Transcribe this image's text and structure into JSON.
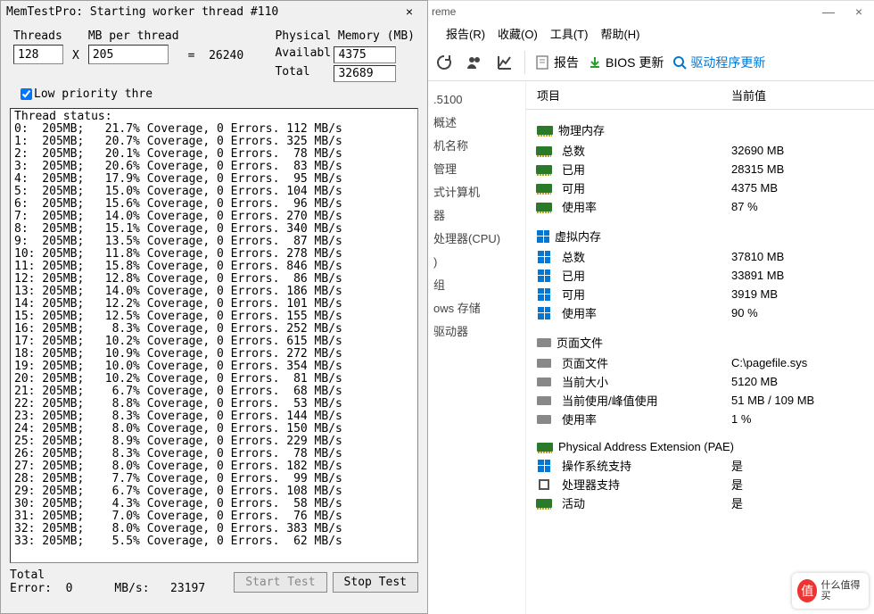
{
  "memtest": {
    "title": "MemTestPro: Starting worker thread #110",
    "close": "×",
    "threads_label": "Threads",
    "threads_value": "128",
    "x": "X",
    "mb_per_thread_label": "MB per thread",
    "mb_per_thread_value": "205",
    "equals": "=",
    "result": "26240",
    "phys_mem_header": "Physical Memory (MB)",
    "available_label": "Availabl",
    "available_value": "4375",
    "total_label": "Total",
    "total_value": "32689",
    "low_priority_label": "Low priority thre",
    "status_header": "Thread status:",
    "threads": [
      {
        "id": "0",
        "mb": "205MB",
        "cov": "21.7%",
        "err": "0",
        "rate": "112"
      },
      {
        "id": "1",
        "mb": "205MB",
        "cov": "20.7%",
        "err": "0",
        "rate": "325"
      },
      {
        "id": "2",
        "mb": "205MB",
        "cov": "20.1%",
        "err": "0",
        "rate": "78"
      },
      {
        "id": "3",
        "mb": "205MB",
        "cov": "20.6%",
        "err": "0",
        "rate": "83"
      },
      {
        "id": "4",
        "mb": "205MB",
        "cov": "17.9%",
        "err": "0",
        "rate": "95"
      },
      {
        "id": "5",
        "mb": "205MB",
        "cov": "15.0%",
        "err": "0",
        "rate": "104"
      },
      {
        "id": "6",
        "mb": "205MB",
        "cov": "15.6%",
        "err": "0",
        "rate": "96"
      },
      {
        "id": "7",
        "mb": "205MB",
        "cov": "14.0%",
        "err": "0",
        "rate": "270"
      },
      {
        "id": "8",
        "mb": "205MB",
        "cov": "15.1%",
        "err": "0",
        "rate": "340"
      },
      {
        "id": "9",
        "mb": "205MB",
        "cov": "13.5%",
        "err": "0",
        "rate": "87"
      },
      {
        "id": "10",
        "mb": "205MB",
        "cov": "11.8%",
        "err": "0",
        "rate": "278"
      },
      {
        "id": "11",
        "mb": "205MB",
        "cov": "15.8%",
        "err": "0",
        "rate": "846"
      },
      {
        "id": "12",
        "mb": "205MB",
        "cov": "12.8%",
        "err": "0",
        "rate": "86"
      },
      {
        "id": "13",
        "mb": "205MB",
        "cov": "14.0%",
        "err": "0",
        "rate": "186"
      },
      {
        "id": "14",
        "mb": "205MB",
        "cov": "12.2%",
        "err": "0",
        "rate": "101"
      },
      {
        "id": "15",
        "mb": "205MB",
        "cov": "12.5%",
        "err": "0",
        "rate": "155"
      },
      {
        "id": "16",
        "mb": "205MB",
        "cov": "8.3%",
        "err": "0",
        "rate": "252"
      },
      {
        "id": "17",
        "mb": "205MB",
        "cov": "10.2%",
        "err": "0",
        "rate": "615"
      },
      {
        "id": "18",
        "mb": "205MB",
        "cov": "10.9%",
        "err": "0",
        "rate": "272"
      },
      {
        "id": "19",
        "mb": "205MB",
        "cov": "10.0%",
        "err": "0",
        "rate": "354"
      },
      {
        "id": "20",
        "mb": "205MB",
        "cov": "10.2%",
        "err": "0",
        "rate": "81"
      },
      {
        "id": "21",
        "mb": "205MB",
        "cov": "6.7%",
        "err": "0",
        "rate": "68"
      },
      {
        "id": "22",
        "mb": "205MB",
        "cov": "8.8%",
        "err": "0",
        "rate": "53"
      },
      {
        "id": "23",
        "mb": "205MB",
        "cov": "8.3%",
        "err": "0",
        "rate": "144"
      },
      {
        "id": "24",
        "mb": "205MB",
        "cov": "8.0%",
        "err": "0",
        "rate": "150"
      },
      {
        "id": "25",
        "mb": "205MB",
        "cov": "8.9%",
        "err": "0",
        "rate": "229"
      },
      {
        "id": "26",
        "mb": "205MB",
        "cov": "8.3%",
        "err": "0",
        "rate": "78"
      },
      {
        "id": "27",
        "mb": "205MB",
        "cov": "8.0%",
        "err": "0",
        "rate": "182"
      },
      {
        "id": "28",
        "mb": "205MB",
        "cov": "7.7%",
        "err": "0",
        "rate": "99"
      },
      {
        "id": "29",
        "mb": "205MB",
        "cov": "6.7%",
        "err": "0",
        "rate": "108"
      },
      {
        "id": "30",
        "mb": "205MB",
        "cov": "4.3%",
        "err": "0",
        "rate": "58"
      },
      {
        "id": "31",
        "mb": "205MB",
        "cov": "7.0%",
        "err": "0",
        "rate": "76"
      },
      {
        "id": "32",
        "mb": "205MB",
        "cov": "8.0%",
        "err": "0",
        "rate": "383"
      },
      {
        "id": "33",
        "mb": "205MB",
        "cov": "5.5%",
        "err": "0",
        "rate": "62"
      }
    ],
    "total_lbl": "Total",
    "error_lbl": "Error:",
    "error_val": "0",
    "mbs_lbl": "MB/s:",
    "mbs_val": "23197",
    "start_btn": "Start Test",
    "stop_btn": "Stop Test"
  },
  "right": {
    "title_suffix": "reme",
    "win_min": "—",
    "win_close": "×",
    "menu": [
      "报告(R)",
      "收藏(O)",
      "工具(T)",
      "帮助(H)"
    ],
    "toolbar": {
      "report": "报告",
      "bios": "BIOS 更新",
      "driver": "驱动程序更新"
    },
    "tree": [
      ".5100",
      "",
      "概述",
      "机名称",
      "",
      "",
      "管理",
      "式计算机",
      "器",
      "",
      "处理器(CPU)",
      ")",
      "",
      "组",
      "",
      "",
      "ows 存储",
      "驱动器"
    ],
    "header_col1": "项目",
    "header_col2": "当前值",
    "groups": [
      {
        "title": "物理内存",
        "icon": "ram",
        "rows": [
          {
            "icon": "ram",
            "label": "总数",
            "value": "32690 MB"
          },
          {
            "icon": "ram",
            "label": "已用",
            "value": "28315 MB"
          },
          {
            "icon": "ram",
            "label": "可用",
            "value": "4375 MB"
          },
          {
            "icon": "ram",
            "label": "使用率",
            "value": "87 %"
          }
        ]
      },
      {
        "title": "虚拟内存",
        "icon": "win",
        "rows": [
          {
            "icon": "win",
            "label": "总数",
            "value": "37810 MB"
          },
          {
            "icon": "win",
            "label": "已用",
            "value": "33891 MB"
          },
          {
            "icon": "win",
            "label": "可用",
            "value": "3919 MB"
          },
          {
            "icon": "win",
            "label": "使用率",
            "value": "90 %"
          }
        ]
      },
      {
        "title": "页面文件",
        "icon": "hdd",
        "rows": [
          {
            "icon": "hdd",
            "label": "页面文件",
            "value": "C:\\pagefile.sys"
          },
          {
            "icon": "hdd",
            "label": "当前大小",
            "value": "5120 MB"
          },
          {
            "icon": "hdd",
            "label": "当前使用/峰值使用",
            "value": "51 MB / 109 MB"
          },
          {
            "icon": "hdd",
            "label": "使用率",
            "value": "1 %"
          }
        ]
      },
      {
        "title": "Physical Address Extension (PAE)",
        "icon": "ram",
        "rows": [
          {
            "icon": "win",
            "label": "操作系统支持",
            "value": "是"
          },
          {
            "icon": "cpu",
            "label": "处理器支持",
            "value": "是"
          },
          {
            "icon": "ram",
            "label": "活动",
            "value": "是"
          }
        ]
      }
    ]
  },
  "watermark": {
    "symbol": "值",
    "text": "什么值得买"
  }
}
